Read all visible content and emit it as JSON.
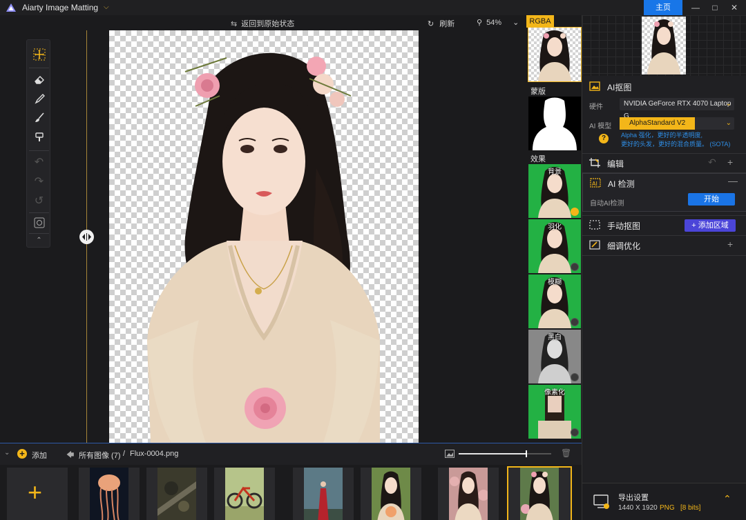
{
  "app": {
    "title": "Aiarty Image Matting",
    "home_label": "主页",
    "window_buttons": [
      "minimize-icon",
      "maximize-icon",
      "close-icon"
    ]
  },
  "canvas_bar": {
    "reset_label": "返回到原始状态",
    "refresh_label": "刷新",
    "zoom": "54%"
  },
  "toolbar": {
    "tools": [
      "move-icon",
      "eraser-icon",
      "brush-icon",
      "restore-brush-icon",
      "paint-bucket-icon",
      "undo-icon",
      "redo-icon",
      "reset-icon",
      "fit-screen-icon",
      "collapse-icon"
    ]
  },
  "thumb_column": {
    "rgba_label": "RGBA",
    "mask_label": "蒙版",
    "effects_label": "效果",
    "effects": [
      {
        "name": "背景",
        "checked": true
      },
      {
        "name": "羽化",
        "checked": false
      },
      {
        "name": "模糊",
        "checked": false
      },
      {
        "name": "黑白",
        "checked": false
      },
      {
        "name": "像素化",
        "checked": false
      }
    ]
  },
  "right_panel": {
    "ai_matting": {
      "title": "AI抠图",
      "hardware_label": "硬件",
      "hardware_value": "NVIDIA GeForce RTX 4070 Laptop G",
      "model_label": "AI 模型",
      "model_value": "AlphaStandard  V2",
      "model_desc_line1": "Alpha 强化，更好的半透明度,",
      "model_desc_line2": "更好的头发，更好的混合质量。  (SOTA)"
    },
    "edit": {
      "title": "编辑"
    },
    "ai_detect": {
      "title": "AI 检测",
      "auto_label": "自动AI检测",
      "start_label": "开始"
    },
    "manual": {
      "title": "手动抠图",
      "add_area_label": "+ 添加区域"
    },
    "refine": {
      "title": "细调优化"
    },
    "export": {
      "title": "导出设置",
      "resolution": "1440 X 1920",
      "format": "PNG",
      "bits": "[8 bits]"
    }
  },
  "bottom": {
    "add_label": "添加",
    "all_images": "所有图像 (7)",
    "separator": "/",
    "filename": "Flux-0004.png",
    "slider_value": 0.73
  },
  "colors": {
    "accent": "#f3b619",
    "blue": "#1a74e6",
    "green_bg": "#23b144",
    "purple": "#4b45d8"
  }
}
